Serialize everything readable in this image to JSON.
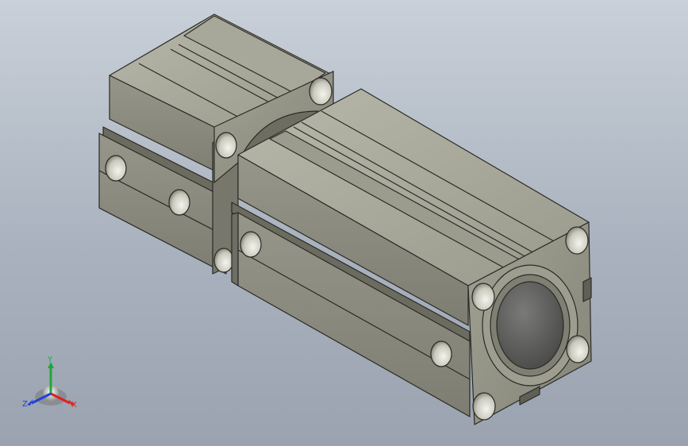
{
  "viewport": {
    "background_top": "#c9d0d9",
    "background_bottom": "#9aa3af"
  },
  "model": {
    "body_color": "#8f8f82",
    "body_highlight": "#b4b4a6",
    "body_shadow": "#5d5d54",
    "edge_color": "#2b2b26",
    "rod_color": "#5a5a58"
  },
  "triad": {
    "x_label": "X",
    "y_label": "Y",
    "z_label": "Z",
    "x_color": "#e0201c",
    "y_color": "#1fa83a",
    "z_color": "#2240d8"
  }
}
